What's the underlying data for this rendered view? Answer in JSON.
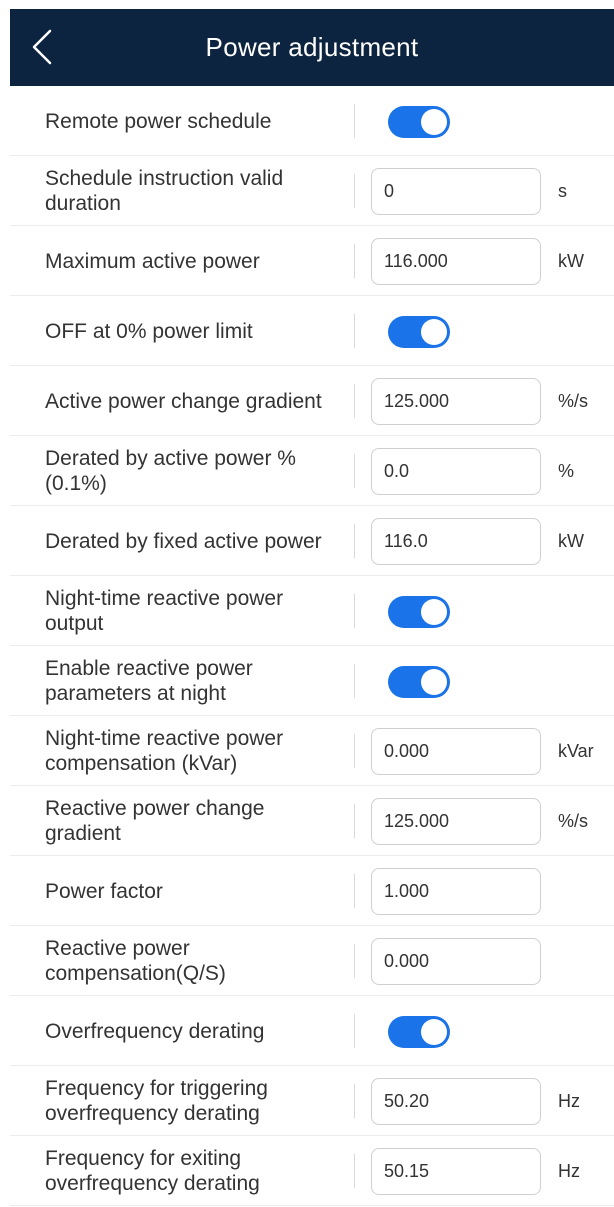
{
  "header": {
    "title": "Power adjustment",
    "back_icon": "chevron-left-icon",
    "background": "#0d2440"
  },
  "accent_color": "#1a73e8",
  "rows": [
    {
      "label": "Remote power schedule",
      "type": "toggle",
      "on": true
    },
    {
      "label": "Schedule instruction valid duration",
      "type": "input",
      "value": "0",
      "unit": "s"
    },
    {
      "label": "Maximum active power",
      "type": "input",
      "value": "116.000",
      "unit": "kW"
    },
    {
      "label": "OFF at 0% power limit",
      "type": "toggle",
      "on": true
    },
    {
      "label": "Active power change gradient",
      "type": "input",
      "value": "125.000",
      "unit": "%/s"
    },
    {
      "label": "Derated by active power % (0.1%)",
      "type": "input",
      "value": "0.0",
      "unit": "%"
    },
    {
      "label": "Derated by fixed active power",
      "type": "input",
      "value": "116.0",
      "unit": "kW"
    },
    {
      "label": "Night-time reactive power output",
      "type": "toggle",
      "on": true
    },
    {
      "label": "Enable reactive power parameters at night",
      "type": "toggle",
      "on": true
    },
    {
      "label": "Night-time reactive power compensation (kVar)",
      "type": "input",
      "value": "0.000",
      "unit": "kVar"
    },
    {
      "label": "Reactive power change gradient",
      "type": "input",
      "value": "125.000",
      "unit": "%/s"
    },
    {
      "label": "Power factor",
      "type": "input",
      "value": "1.000",
      "unit": ""
    },
    {
      "label": "Reactive power compensation(Q/S)",
      "type": "input",
      "value": "0.000",
      "unit": ""
    },
    {
      "label": "Overfrequency derating",
      "type": "toggle",
      "on": true
    },
    {
      "label": "Frequency for triggering overfrequency derating",
      "type": "input",
      "value": "50.20",
      "unit": "Hz"
    },
    {
      "label": "Frequency for exiting overfrequency derating",
      "type": "input",
      "value": "50.15",
      "unit": "Hz"
    }
  ]
}
